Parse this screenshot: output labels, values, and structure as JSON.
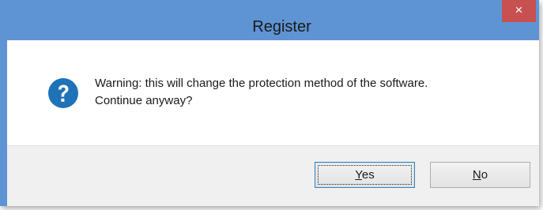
{
  "window": {
    "title": "Register",
    "close_glyph": "×"
  },
  "message": {
    "icon": "question-icon",
    "line1": "Warning: this will change the protection method of the software.",
    "line2": "Continue anyway?"
  },
  "buttons": {
    "yes": {
      "accel": "Y",
      "rest": "es"
    },
    "no": {
      "accel": "N",
      "rest": "o"
    }
  },
  "colors": {
    "titlebar": "#5e94d4",
    "close_button": "#c75050",
    "icon": "#1e72b8"
  }
}
